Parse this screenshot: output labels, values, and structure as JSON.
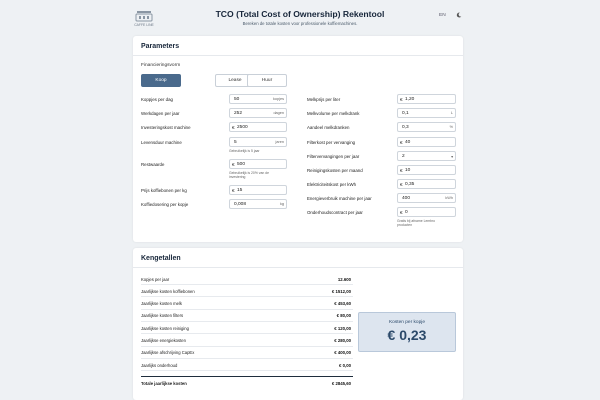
{
  "header": {
    "title": "TCO (Total Cost of Ownership) Rekentool",
    "subtitle": "Bereken de totale kosten voor professionele koffiemachines.",
    "language": "EN",
    "logo_text": "CAFFE LINE"
  },
  "parameters": {
    "title": "Parameters",
    "financing_label": "Financieringsvorm",
    "financing_options": [
      "Koop",
      "Lease",
      "Huur"
    ],
    "financing_selected": "Koop",
    "left": [
      {
        "label": "Koppjes per dag",
        "prefix": "",
        "value": "50",
        "suffix": "kopjes"
      },
      {
        "label": "Werkdagen per jaar",
        "prefix": "",
        "value": "252",
        "suffix": "dagen"
      },
      {
        "label": "Investeringskost machine",
        "prefix": "€",
        "value": "2500",
        "suffix": ""
      },
      {
        "label": "Levensduur machine",
        "prefix": "",
        "value": "5",
        "suffix": "jaren",
        "help": "Gebruikelijk is 5 jaar"
      },
      {
        "label": "Restwaarde",
        "prefix": "€",
        "value": "500",
        "suffix": "",
        "help": "Gebruikelijk is 20% van de investering"
      },
      {
        "label": "Prijs koffiebonen per kg",
        "prefix": "€",
        "value": "15",
        "suffix": ""
      },
      {
        "label": "Koffiedosering per kopje",
        "prefix": "",
        "value": "0,008",
        "suffix": "kg"
      }
    ],
    "right": [
      {
        "label": "Melkprijs per liter",
        "prefix": "€",
        "value": "1,20",
        "suffix": ""
      },
      {
        "label": "Melkvolume per melkdrank",
        "prefix": "",
        "value": "0,1",
        "suffix": "L"
      },
      {
        "label": "Aandeel melkdranken",
        "prefix": "",
        "value": "0,3",
        "suffix": "%"
      },
      {
        "label": "Filterkost per vervanging",
        "prefix": "€",
        "value": "40",
        "suffix": ""
      },
      {
        "label": "Filtervervangingen per jaar",
        "prefix": "",
        "value": "2",
        "suffix": "▾"
      },
      {
        "label": "Reinigingskosten per maand",
        "prefix": "€",
        "value": "10",
        "suffix": ""
      },
      {
        "label": "Elektriciteitskost per kWh",
        "prefix": "€",
        "value": "0,35",
        "suffix": ""
      },
      {
        "label": "Energieverbruik machine per jaar",
        "prefix": "",
        "value": "400",
        "suffix": "kWh"
      },
      {
        "label": "Onderhoudscontract per jaar",
        "prefix": "€",
        "value": "0",
        "suffix": "",
        "help": "Gratis bij afname Lembro producten"
      }
    ]
  },
  "kpis": {
    "title": "Kengetallen",
    "rows": [
      {
        "label": "Kopjes per jaar",
        "value": "12.600"
      },
      {
        "label": "Jaarlijkse kosten koffiebonen",
        "value": "€ 1512,00"
      },
      {
        "label": "Jaarlijkse kosten melk",
        "value": "€ 453,60"
      },
      {
        "label": "Jaarlijkse kosten filters",
        "value": "€ 80,00"
      },
      {
        "label": "Jaarlijkse kosten reiniging",
        "value": "€ 120,00"
      },
      {
        "label": "Jaarlijkse energiekosten",
        "value": "€ 280,00"
      },
      {
        "label": "Jaarlijkse afschrijving CapEx",
        "value": "€ 400,00"
      },
      {
        "label": "Jaarlijks onderhoud",
        "value": "€ 0,00"
      }
    ],
    "total": {
      "label": "Totale jaarlijkse kosten",
      "value": "€ 2845,60"
    },
    "cost_per_cup_label": "Kosten per kopje",
    "cost_per_cup_value": "€ 0,23"
  },
  "colors": {
    "accent": "#4a6a8c",
    "highlight_bg": "#dde5ef",
    "page_bg": "#eef1f4"
  },
  "icons": {
    "theme_toggle": "moon-icon",
    "logo": "caffe-logo-icon"
  }
}
